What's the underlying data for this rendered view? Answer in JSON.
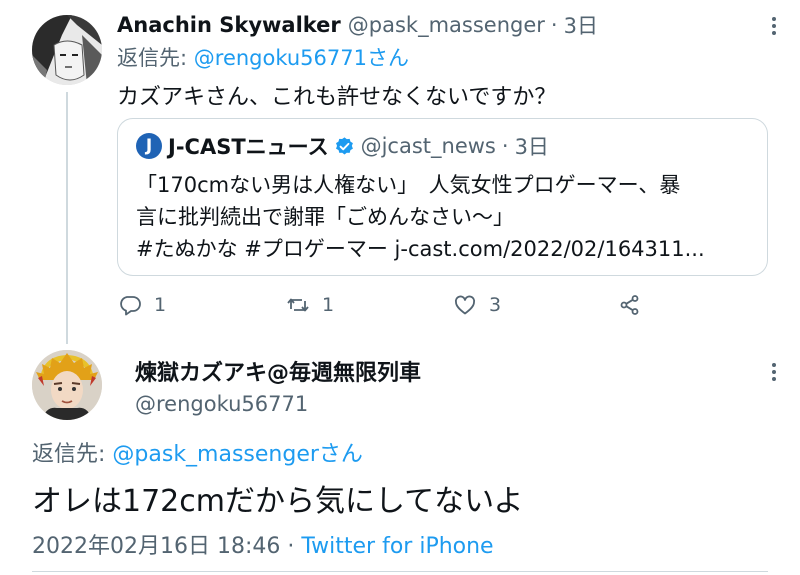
{
  "reply_tweet": {
    "author_name": "Anachin Skywalker",
    "author_handle": "@pask_massenger",
    "separator": "·",
    "time": "3日",
    "reply_prefix": "返信先: ",
    "reply_target": "@rengoku56771さん",
    "text": "カズアキさん、これも許せなくないですか？",
    "quote": {
      "avatar_letter": "J",
      "author_name": "J-CASTニュース",
      "author_handle": "@jcast_news",
      "separator": "·",
      "time": "3日",
      "lines": [
        "「170cmない男は人権ない」　人気女性プロゲーマー、暴",
        "言に批判続出で謝罪「ごめんなさい〜」",
        "#たぬかな #プロゲーマー  j-cast.com/2022/02/164311..."
      ]
    },
    "actions": {
      "reply_count": "1",
      "retweet_count": "1",
      "like_count": "3"
    }
  },
  "main_tweet": {
    "author_name": "煉獄カズアキ@毎週無限列車",
    "author_handle": "@rengoku56771",
    "reply_prefix": "返信先: ",
    "reply_target": "@pask_massengerさん",
    "text": "オレは172cmだから気にしてないよ",
    "timestamp": "2022年02月16日 18:46",
    "separator": " · ",
    "client": "Twitter for iPhone"
  },
  "colors": {
    "accent": "#1d9bf0",
    "muted": "#536471",
    "border": "#cfd9de"
  }
}
